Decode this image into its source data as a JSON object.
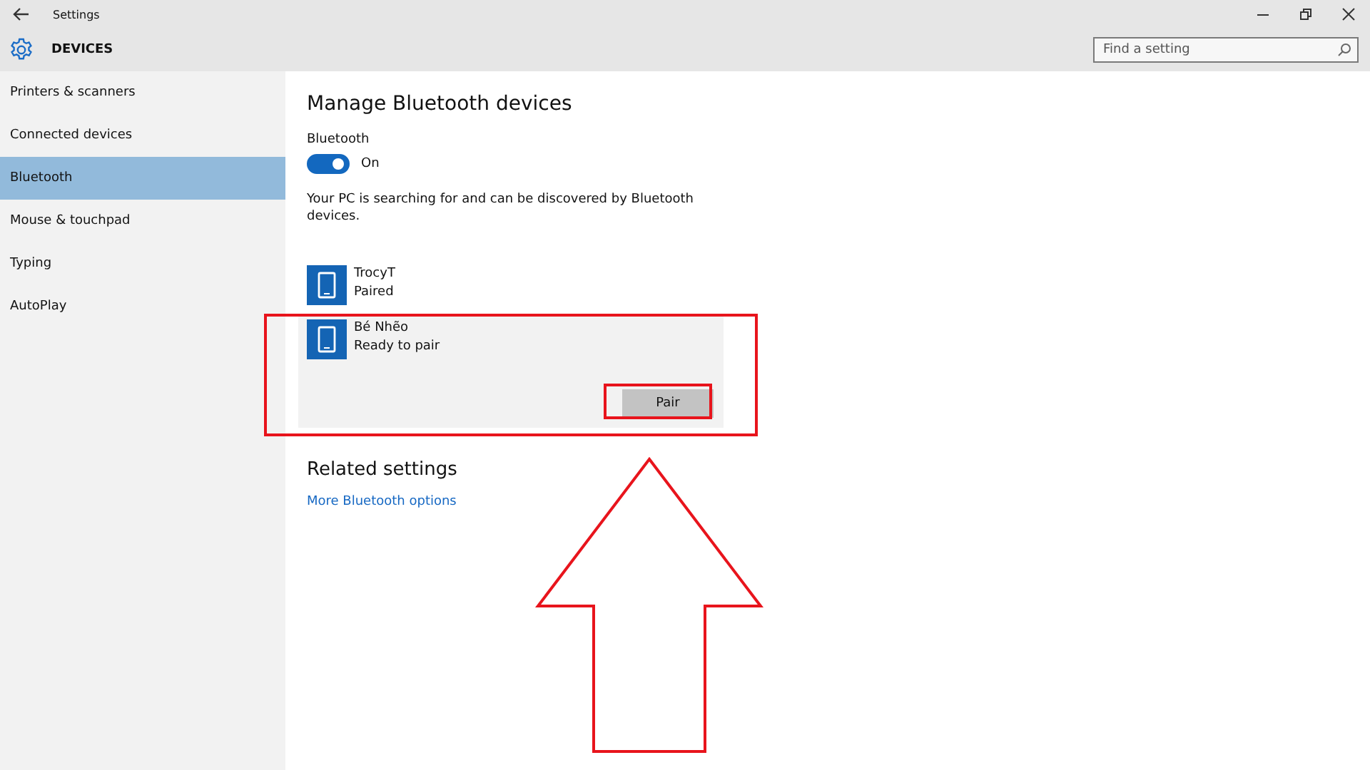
{
  "window": {
    "title": "Settings"
  },
  "header": {
    "title": "DEVICES",
    "search": {
      "placeholder": "Find a setting"
    }
  },
  "sidebar": {
    "items": [
      {
        "label": "Printers & scanners",
        "selected": false
      },
      {
        "label": "Connected devices",
        "selected": false
      },
      {
        "label": "Bluetooth",
        "selected": true
      },
      {
        "label": "Mouse & touchpad",
        "selected": false
      },
      {
        "label": "Typing",
        "selected": false
      },
      {
        "label": "AutoPlay",
        "selected": false
      }
    ]
  },
  "content": {
    "title": "Manage Bluetooth devices",
    "toggle": {
      "label": "Bluetooth",
      "on": true,
      "state_text": "On"
    },
    "description": "Your PC is searching for and can be discovered by Bluetooth devices.",
    "devices": [
      {
        "name": "TrocyT",
        "status": "Paired",
        "selected": false
      },
      {
        "name": "Bé Nhẽo",
        "status": "Ready to pair",
        "selected": true,
        "action": "Pair"
      }
    ],
    "related": {
      "title": "Related settings",
      "link": "More Bluetooth options"
    }
  }
}
